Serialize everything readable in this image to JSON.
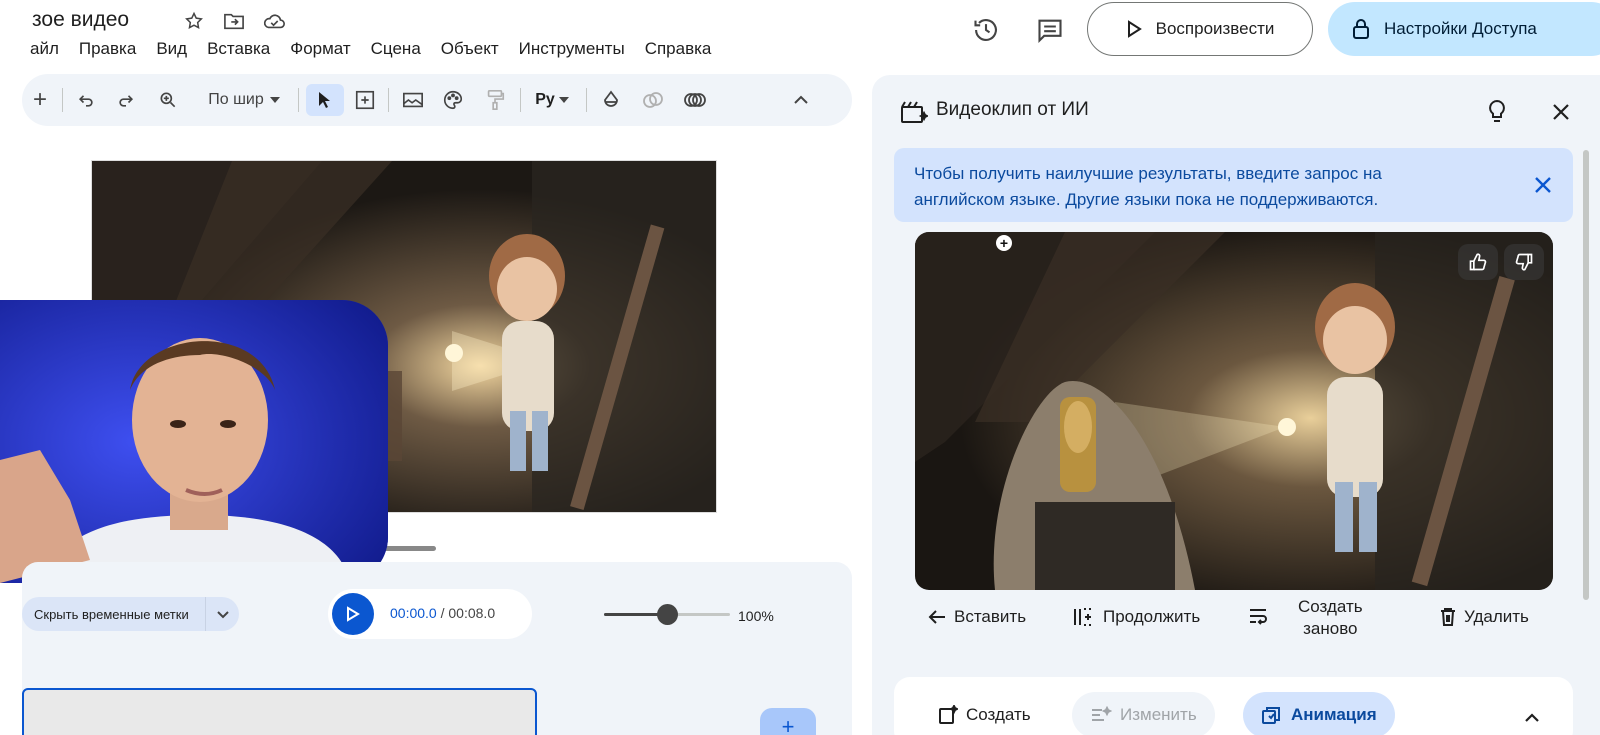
{
  "document": {
    "title": "зое видео"
  },
  "menu": [
    "айл",
    "Правка",
    "Вид",
    "Вставка",
    "Формат",
    "Сцена",
    "Объект",
    "Инструменты",
    "Справка"
  ],
  "header": {
    "play_label": "Воспроизвести",
    "access_label": "Настройки Доступа"
  },
  "toolbar": {
    "zoom_label": "По шир",
    "lang_label": "Ру"
  },
  "playback": {
    "hide_timestamps_label": "Скрыть временные метки",
    "current_time": "00:00.0",
    "separator": " / ",
    "total_time": "00:08.0",
    "volume_percent_label": "100%",
    "volume_level": 0.5
  },
  "side_panel": {
    "title": "Видеоклип от ИИ",
    "banner_text": "Чтобы получить наилучшие результаты, введите запрос на английском языке. Другие языки пока не поддерживаются.",
    "actions": {
      "insert": "Вставить",
      "continue": "Продолжить",
      "recreate_line1": "Создать",
      "recreate_line2": "заново",
      "delete": "Удалить"
    },
    "modes": {
      "create": "Создать",
      "edit": "Изменить",
      "animate": "Анимация"
    }
  },
  "colors": {
    "accent": "#0b57d0",
    "access_button": "#c2e7ff",
    "banner": "#d3e3fd",
    "panel": "#f0f4f9"
  }
}
